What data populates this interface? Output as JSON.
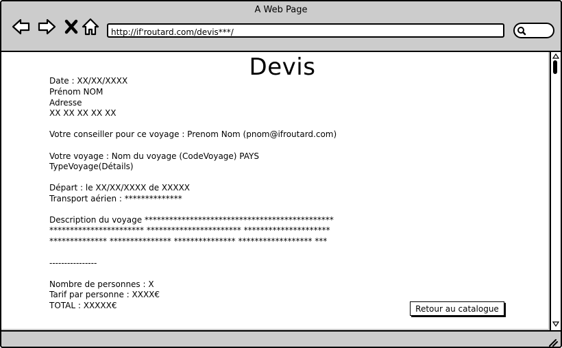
{
  "window": {
    "title": "A Web Page"
  },
  "browser": {
    "url": "http://if'routard.com/devis***/",
    "icons": [
      "back-icon",
      "forward-icon",
      "close-icon",
      "home-icon",
      "search-icon"
    ]
  },
  "page": {
    "title": "Devis",
    "client": {
      "date": "Date : XX/XX/XXXX",
      "name": "Prénom NOM",
      "address": "Adresse",
      "phone": "XX XX XX XX XX"
    },
    "advisor": "Votre conseiller pour ce voyage : Prenom Nom (pnom@ifroutard.com)",
    "trip": {
      "name": "Votre voyage : Nom du voyage (CodeVoyage) PAYS",
      "type": "TypeVoyage(Détails)"
    },
    "departure": {
      "date": "Départ : le XX/XX/XXXX de XXXXX",
      "transport": "Transport aérien : **************"
    },
    "description": {
      "line1": "Description du voyage **********************************************",
      "line2": "*********************** *********************** *********************",
      "line3": "************** *************** *************** ****************** ***"
    },
    "separator": "----------------",
    "pricing": {
      "persons": "Nombre de personnes : X",
      "price_per_person": "Tarif par personne : XXXX€",
      "total": "TOTAL : XXXXX€"
    },
    "back_button": "Retour au catalogue"
  }
}
